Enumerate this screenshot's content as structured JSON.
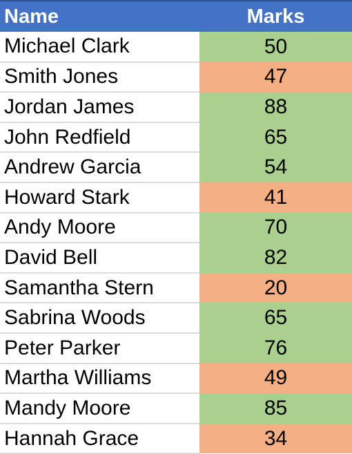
{
  "headers": {
    "name": "Name",
    "marks": "Marks"
  },
  "colors": {
    "header": "#4472C4",
    "pass": "#A9D08E",
    "fail": "#F4B084"
  },
  "rows": [
    {
      "name": "Michael Clark",
      "marks": "50",
      "status": "pass"
    },
    {
      "name": "Smith Jones",
      "marks": "47",
      "status": "fail"
    },
    {
      "name": "Jordan James",
      "marks": "88",
      "status": "pass"
    },
    {
      "name": "John Redfield",
      "marks": "65",
      "status": "pass"
    },
    {
      "name": "Andrew Garcia",
      "marks": "54",
      "status": "pass"
    },
    {
      "name": "Howard Stark",
      "marks": "41",
      "status": "fail"
    },
    {
      "name": "Andy Moore",
      "marks": "70",
      "status": "pass"
    },
    {
      "name": "David Bell",
      "marks": "82",
      "status": "pass"
    },
    {
      "name": "Samantha Stern",
      "marks": "20",
      "status": "fail"
    },
    {
      "name": "Sabrina Woods",
      "marks": "65",
      "status": "pass"
    },
    {
      "name": "Peter Parker",
      "marks": "76",
      "status": "pass"
    },
    {
      "name": "Martha Williams",
      "marks": "49",
      "status": "fail"
    },
    {
      "name": "Mandy Moore",
      "marks": "85",
      "status": "pass"
    },
    {
      "name": "Hannah Grace",
      "marks": "34",
      "status": "fail"
    }
  ]
}
